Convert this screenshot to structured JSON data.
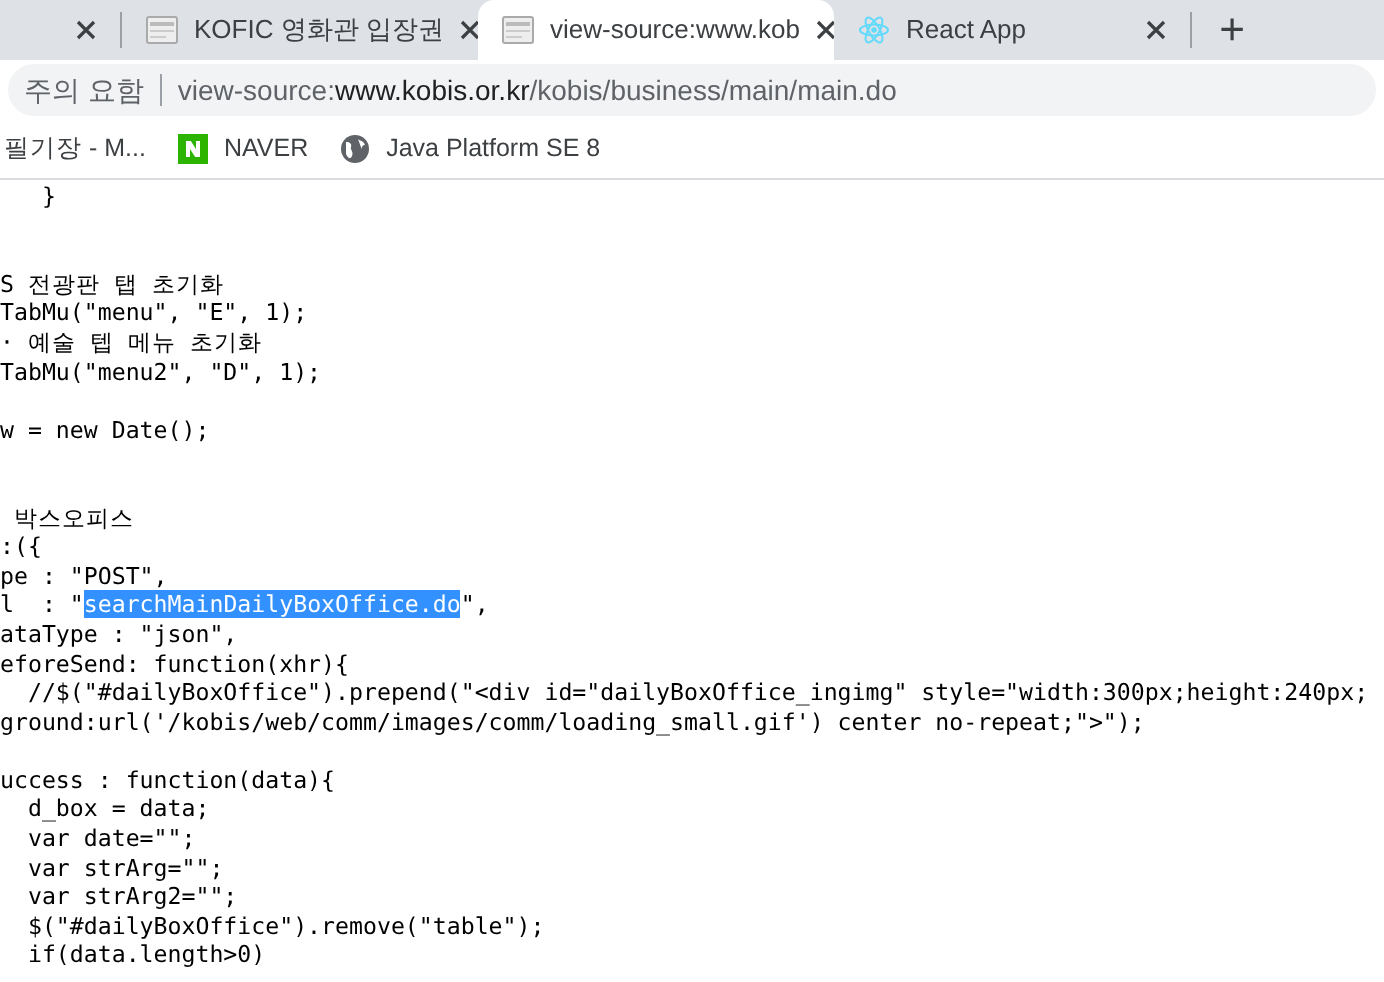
{
  "tabs": [
    {
      "selected": false,
      "kind": "blank"
    },
    {
      "title": "KOFIC 영화관 입장권",
      "selected": false,
      "kind": "page"
    },
    {
      "title": "view-source:www.kob",
      "selected": true,
      "kind": "page"
    },
    {
      "title": "React App",
      "selected": false,
      "kind": "react"
    }
  ],
  "new_tab": "+",
  "address_bar": {
    "security": "주의 요함",
    "scheme": "view-source:",
    "host": "www.kobis.or.kr",
    "path": "/kobis/business/main/main.do"
  },
  "bookmarks": [
    {
      "title": "필기장 - M...",
      "kind": "plain"
    },
    {
      "title": "NAVER",
      "kind": "naver"
    },
    {
      "title": "Java Platform SE 8",
      "kind": "globe"
    }
  ],
  "source_lines": [
    {
      "kind": "code",
      "text": "   }"
    },
    {
      "kind": "blank"
    },
    {
      "kind": "blank"
    },
    {
      "kind": "code",
      "text": "S 전광판 탭 초기화"
    },
    {
      "kind": "code",
      "text": "TabMu(\"menu\", \"E\", 1);"
    },
    {
      "kind": "code",
      "text": "· 예술 텝 메뉴 초기화"
    },
    {
      "kind": "code",
      "text": "TabMu(\"menu2\", \"D\", 1);"
    },
    {
      "kind": "blank"
    },
    {
      "kind": "code",
      "text": "w = new Date();"
    },
    {
      "kind": "blank"
    },
    {
      "kind": "blank"
    },
    {
      "kind": "code",
      "text": " 박스오피스"
    },
    {
      "kind": "code",
      "text": ":({"
    },
    {
      "kind": "code",
      "text": "pe : \"POST\","
    },
    {
      "kind": "code",
      "text": "l  : \"",
      "selected_text": "searchMainDailyBoxOffice.do",
      "after": "\","
    },
    {
      "kind": "code",
      "text": "ataType : \"json\","
    },
    {
      "kind": "code",
      "text": "eforeSend: function(xhr){"
    },
    {
      "kind": "code",
      "text": "  //$(\"#dailyBoxOffice\").prepend(\"<div id=\"dailyBoxOffice_ingimg\" style=\"width:300px;height:240px;"
    },
    {
      "kind": "code",
      "text": "ground:url('/kobis/web/comm/images/comm/loading_small.gif') center no-repeat;\">\");"
    },
    {
      "kind": "blank"
    },
    {
      "kind": "code",
      "text": "uccess : function(data){"
    },
    {
      "kind": "code",
      "text": "  d_box = data;"
    },
    {
      "kind": "code",
      "text": "  var date=\"\";"
    },
    {
      "kind": "code",
      "text": "  var strArg=\"\";"
    },
    {
      "kind": "code",
      "text": "  var strArg2=\"\";"
    },
    {
      "kind": "code",
      "text": "  $(\"#dailyBoxOffice\").remove(\"table\");"
    },
    {
      "kind": "code",
      "text": "  if(data.length>0)"
    }
  ]
}
